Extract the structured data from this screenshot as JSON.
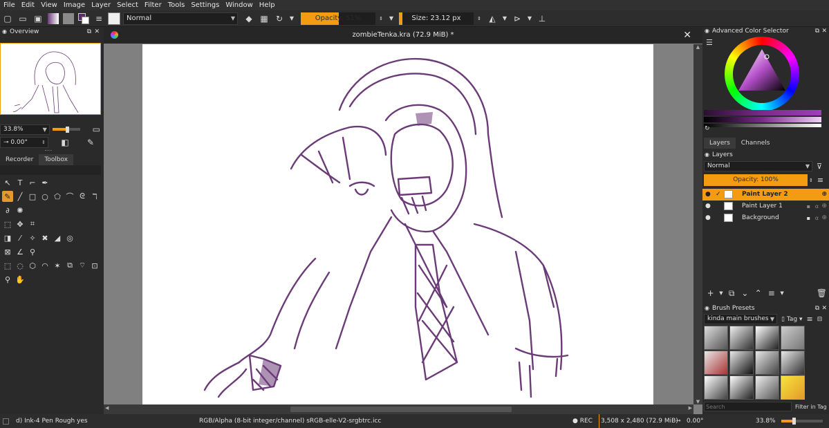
{
  "menu": [
    "File",
    "Edit",
    "View",
    "Image",
    "Layer",
    "Select",
    "Filter",
    "Tools",
    "Settings",
    "Window",
    "Help"
  ],
  "toolbar": {
    "blend_mode": "Normal",
    "opacity": "Opacity: 51%",
    "opacity_fraction": 0.51,
    "size": "Size: 23.12 px",
    "size_fraction": 0.05
  },
  "overview": {
    "title": "Overview",
    "zoom": "33.8%",
    "rotation": "0.00°"
  },
  "left_tabs": [
    "Recorder",
    "Toolbox"
  ],
  "document": {
    "title": "zombieTenka.kra (72.9 MiB) *"
  },
  "color_selector": {
    "title": "Advanced Color Selector"
  },
  "layers": {
    "tabs": [
      "Layers",
      "Channels"
    ],
    "title": "Layers",
    "blend_mode": "Normal",
    "opacity": "Opacity:  100%",
    "items": [
      {
        "name": "Paint Layer 2",
        "active": true
      },
      {
        "name": "Paint Layer 1",
        "active": false
      },
      {
        "name": "Background",
        "active": false
      }
    ]
  },
  "brush_presets": {
    "title": "Brush Presets",
    "tag": "kinda main brushes",
    "tag_button": "Tag",
    "search_placeholder": "Search",
    "filter_label": "Filter in Tag"
  },
  "status": {
    "brush": "d) Ink-4 Pen Rough yes",
    "color_info": "RGB/Alpha (8-bit integer/channel)  sRGB-elle-V2-srgbtrc.icc",
    "rec": "● REC",
    "dimensions": "3,508 x 2,480 (72.9 MiB)",
    "rotation": "0.00°",
    "zoom": "33.8%"
  },
  "colors": {
    "accent": "#f39c12",
    "ink": "#6b3b78"
  }
}
